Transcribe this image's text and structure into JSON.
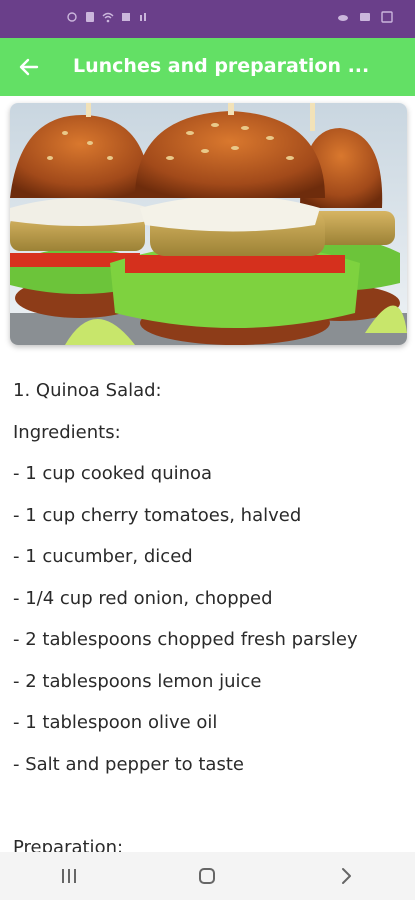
{
  "status_bar": {
    "left_icons": [
      "alarm-icon",
      "sim-icon",
      "wifi-icon",
      "notification-icon",
      "data-icon"
    ],
    "right_icons": [
      "cloud-icon",
      "message-icon",
      "image-icon"
    ]
  },
  "app_bar": {
    "title": "Lunches and preparation ...",
    "back_icon": "arrow-left-icon",
    "color": "#63e065"
  },
  "hero_image": {
    "subject": "veggie-burgers-photo"
  },
  "recipe": {
    "title": "1. Quinoa Salad:",
    "ingredients_label": "Ingredients:",
    "ingredients": [
      "- 1 cup cooked quinoa",
      "- 1 cup cherry tomatoes, halved",
      "- 1 cucumber, diced",
      "- 1/4 cup red onion, chopped",
      "- 2 tablespoons chopped fresh parsley",
      "- 2 tablespoons lemon juice",
      "- 1 tablespoon olive oil",
      "- Salt and pepper to taste"
    ],
    "preparation_label": "Preparation:"
  },
  "nav_bar": {
    "icons": [
      "recent-apps-icon",
      "home-icon",
      "back-icon"
    ]
  },
  "colors": {
    "status_bar": "#6a3f8a",
    "app_bar": "#63e065",
    "nav_bar": "#f4f4f4"
  }
}
